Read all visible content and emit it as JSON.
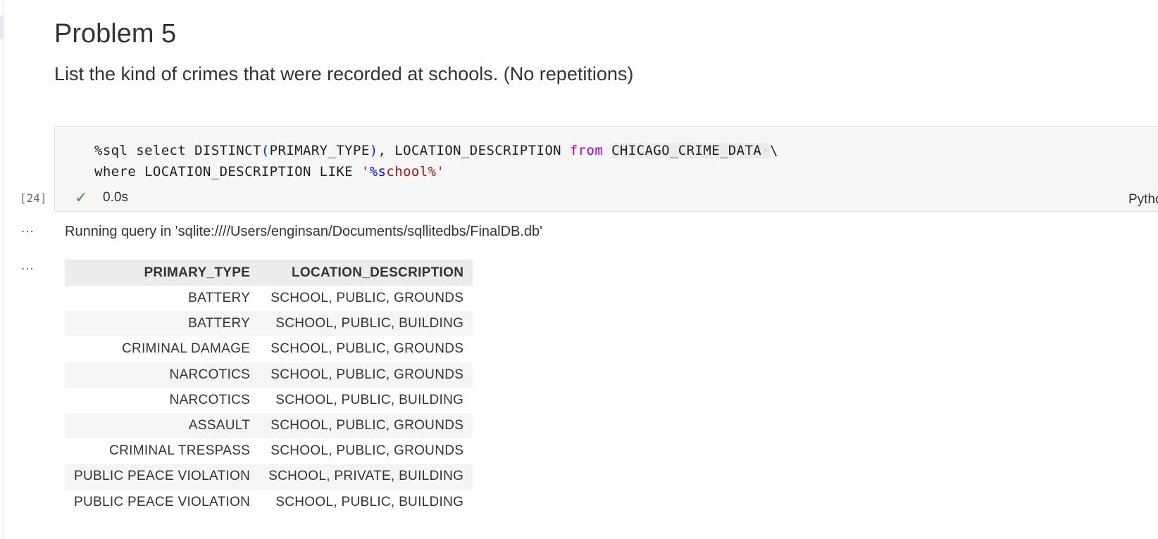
{
  "markdown": {
    "heading": "Problem 5",
    "question": "List the kind of crimes that were recorded at schools. (No repetitions)"
  },
  "code_cell": {
    "execution_count": "[24]",
    "status_icon": "check-icon",
    "exec_time": "0.0s",
    "kernel_label": "Python",
    "line1": {
      "magic": "%sql select DISTINCT",
      "open_paren": "(",
      "arg": "PRIMARY_TYPE",
      "close_paren": ")",
      "cols": ", LOCATION_DESCRIPTION ",
      "from_kw": "from",
      "space": " ",
      "table": "CHICAGO_CRIME_DATA",
      "ws_dot": "·",
      "cont": "\\"
    },
    "line2": {
      "prefix": "where LOCATION_DESCRIPTION LIKE ",
      "q1": "'",
      "fmt": "%s",
      "rest": "chool%'"
    }
  },
  "outputs": {
    "dots": "...",
    "query_message": "Running query in 'sqlite:////Users/enginsan/Documents/sqllitedbs/FinalDB.db'",
    "table": {
      "columns": [
        "PRIMARY_TYPE",
        "LOCATION_DESCRIPTION"
      ],
      "rows": [
        [
          "BATTERY",
          "SCHOOL, PUBLIC, GROUNDS"
        ],
        [
          "BATTERY",
          "SCHOOL, PUBLIC, BUILDING"
        ],
        [
          "CRIMINAL DAMAGE",
          "SCHOOL, PUBLIC, GROUNDS"
        ],
        [
          "NARCOTICS",
          "SCHOOL, PUBLIC, GROUNDS"
        ],
        [
          "NARCOTICS",
          "SCHOOL, PUBLIC, BUILDING"
        ],
        [
          "ASSAULT",
          "SCHOOL, PUBLIC, GROUNDS"
        ],
        [
          "CRIMINAL TRESPASS",
          "SCHOOL, PUBLIC, GROUNDS"
        ],
        [
          "PUBLIC PEACE VIOLATION",
          "SCHOOL, PRIVATE, BUILDING"
        ],
        [
          "PUBLIC PEACE VIOLATION",
          "SCHOOL, PUBLIC, BUILDING"
        ]
      ]
    }
  },
  "colors": {
    "keyword": "#af00db",
    "string": "#a31515",
    "paren": "#0431fa",
    "success": "#3a9b3a"
  }
}
